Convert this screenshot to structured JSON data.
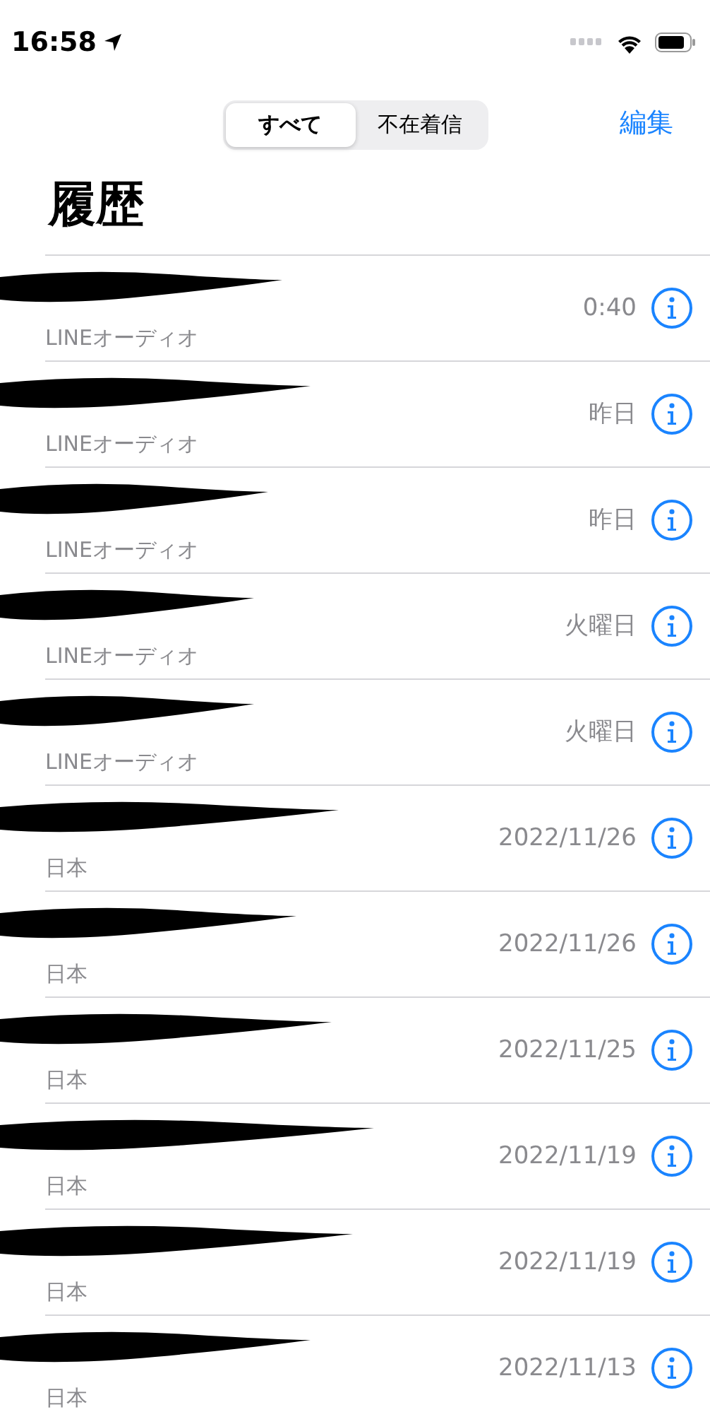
{
  "status_bar": {
    "time": "16:58"
  },
  "segments": [
    {
      "label": "すべて",
      "selected": true
    },
    {
      "label": "不在着信",
      "selected": false
    }
  ],
  "edit_button": "編集",
  "title": "履歴",
  "calls": [
    {
      "subtitle": "LINEオーディオ",
      "time": "0:40"
    },
    {
      "subtitle": "LINEオーディオ",
      "time": "昨日"
    },
    {
      "subtitle": "LINEオーディオ",
      "time": "昨日"
    },
    {
      "subtitle": "LINEオーディオ",
      "time": "火曜日"
    },
    {
      "subtitle": "LINEオーディオ",
      "time": "火曜日"
    },
    {
      "subtitle": "日本",
      "time": "2022/11/26"
    },
    {
      "subtitle": "日本",
      "time": "2022/11/26"
    },
    {
      "subtitle": "日本",
      "time": "2022/11/25"
    },
    {
      "subtitle": "日本",
      "time": "2022/11/19"
    },
    {
      "subtitle": "日本",
      "time": "2022/11/19"
    },
    {
      "subtitle": "日本",
      "time": "2022/11/13"
    }
  ]
}
